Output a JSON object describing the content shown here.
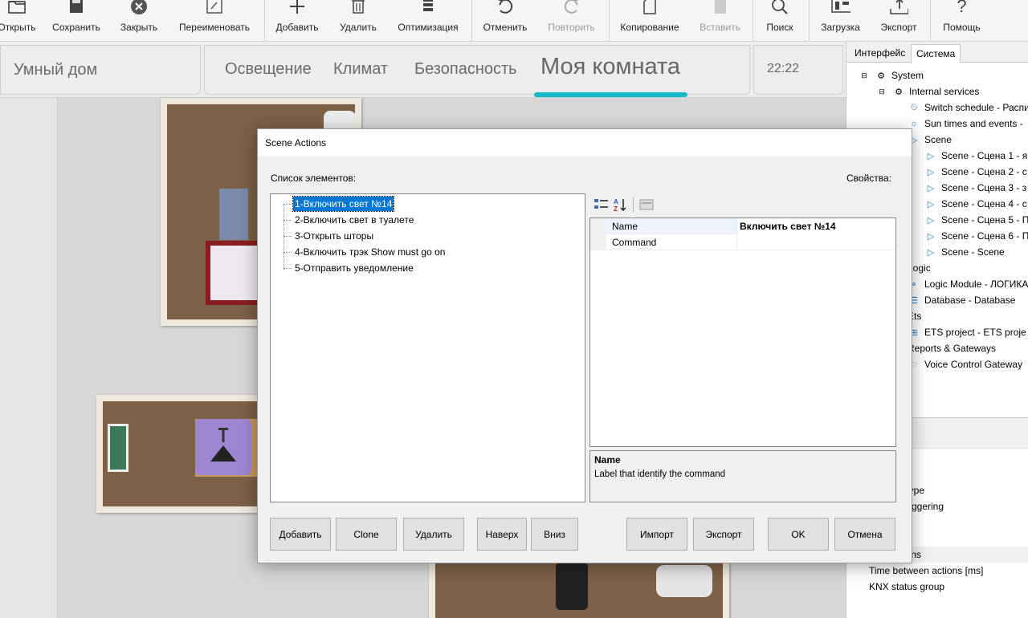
{
  "toolbar": {
    "items": [
      {
        "label": "Открыть",
        "icon": "folder-icon",
        "disabled": false
      },
      {
        "label": "Сохранить",
        "icon": "save-icon",
        "disabled": false
      },
      {
        "label": "Закрыть",
        "icon": "close-circle-icon",
        "disabled": false
      },
      {
        "label": "Переименовать",
        "icon": "rename-icon",
        "disabled": false
      },
      {
        "label": "Добавить",
        "icon": "plus-icon",
        "disabled": false
      },
      {
        "label": "Удалить",
        "icon": "trash-icon",
        "disabled": false
      },
      {
        "label": "Оптимизация",
        "icon": "optimize-icon",
        "disabled": false
      },
      {
        "label": "Отменить",
        "icon": "undo-icon",
        "disabled": false
      },
      {
        "label": "Повторить",
        "icon": "redo-icon",
        "disabled": true
      },
      {
        "label": "Копирование",
        "icon": "copy-icon",
        "disabled": false
      },
      {
        "label": "Вставить",
        "icon": "paste-icon",
        "disabled": true
      },
      {
        "label": "Поиск",
        "icon": "search-icon",
        "disabled": false
      },
      {
        "label": "Загрузка",
        "icon": "upload-icon",
        "disabled": false
      },
      {
        "label": "Экспорт",
        "icon": "export-icon",
        "disabled": false
      },
      {
        "label": "Помощь",
        "icon": "help-icon",
        "disabled": false
      }
    ]
  },
  "app_header": {
    "home_title": "Умный дом",
    "tabs": [
      "Освещение",
      "Климат",
      "Безопасность",
      "Моя комната"
    ],
    "active_tab": "Моя комната",
    "time": "22:22",
    "accent_color": "#18b8c8"
  },
  "right_panel": {
    "tabs": [
      "Интерфейс",
      "Система"
    ],
    "active_tab": "Система",
    "tree": [
      {
        "label": "System",
        "icon": "system-gear-icon"
      },
      {
        "label": "Internal services",
        "icon": "gear-icon"
      },
      {
        "label": "Switch schedule - Распи",
        "icon": "schedule-icon"
      },
      {
        "label": "Sun times and events - ",
        "icon": "sun-icon"
      },
      {
        "label": "Scene",
        "icon": "scene-icon"
      },
      {
        "label": "Scene - Сцена 1 - я",
        "icon": "scene-icon"
      },
      {
        "label": "Scene - Сцена 2 - с",
        "icon": "scene-icon"
      },
      {
        "label": "Scene - Сцена 3 - з",
        "icon": "scene-icon"
      },
      {
        "label": "Scene - Сцена 4 - с",
        "icon": "scene-icon"
      },
      {
        "label": "Scene - Сцена 5 - П",
        "icon": "scene-icon"
      },
      {
        "label": "Scene - Сцена 6 - П",
        "icon": "scene-icon"
      },
      {
        "label": "Scene - Scene",
        "icon": "scene-icon"
      },
      {
        "label": "Logic",
        "icon": "logic-icon"
      },
      {
        "label": "Logic Module - ЛОГИКА",
        "icon": "logic-module-icon"
      },
      {
        "label": "Database - Database",
        "icon": "database-icon"
      },
      {
        "label": "Ets",
        "icon": "ets-icon"
      },
      {
        "label": "ETS project - ETS proje",
        "icon": "ets-project-icon"
      },
      {
        "label": "Reports & Gateways",
        "icon": "gateway-icon"
      },
      {
        "label": "Voice Control Gateway",
        "icon": "voice-icon"
      }
    ],
    "properties": [
      "p",
      "Type",
      "triggering",
      "",
      "le",
      "ions",
      "Time between actions [ms]",
      "KNX status group"
    ]
  },
  "dialog": {
    "title": "Scene Actions",
    "list_label": "Список элементов:",
    "props_label": "Свойства:",
    "items": [
      "1-Включить свет №14",
      "2-Включить свет в туалете",
      "3-Открыть шторы",
      "4-Включить трэк Show must go on",
      "5-Отправить уведомление"
    ],
    "selected_index": 0,
    "grid": [
      {
        "name": "Name",
        "value": "Включить свет №14"
      },
      {
        "name": "Command",
        "value": ""
      }
    ],
    "help_title": "Name",
    "help_text": "Label that identify the command",
    "buttons": {
      "add": "Добавить",
      "clone": "Clone",
      "delete": "Удалить",
      "up": "Наверх",
      "down": "Вниз",
      "import": "Импорт",
      "export": "Экспорт",
      "ok": "OK",
      "cancel": "Отмена"
    },
    "selection_color": "#0078d7"
  }
}
